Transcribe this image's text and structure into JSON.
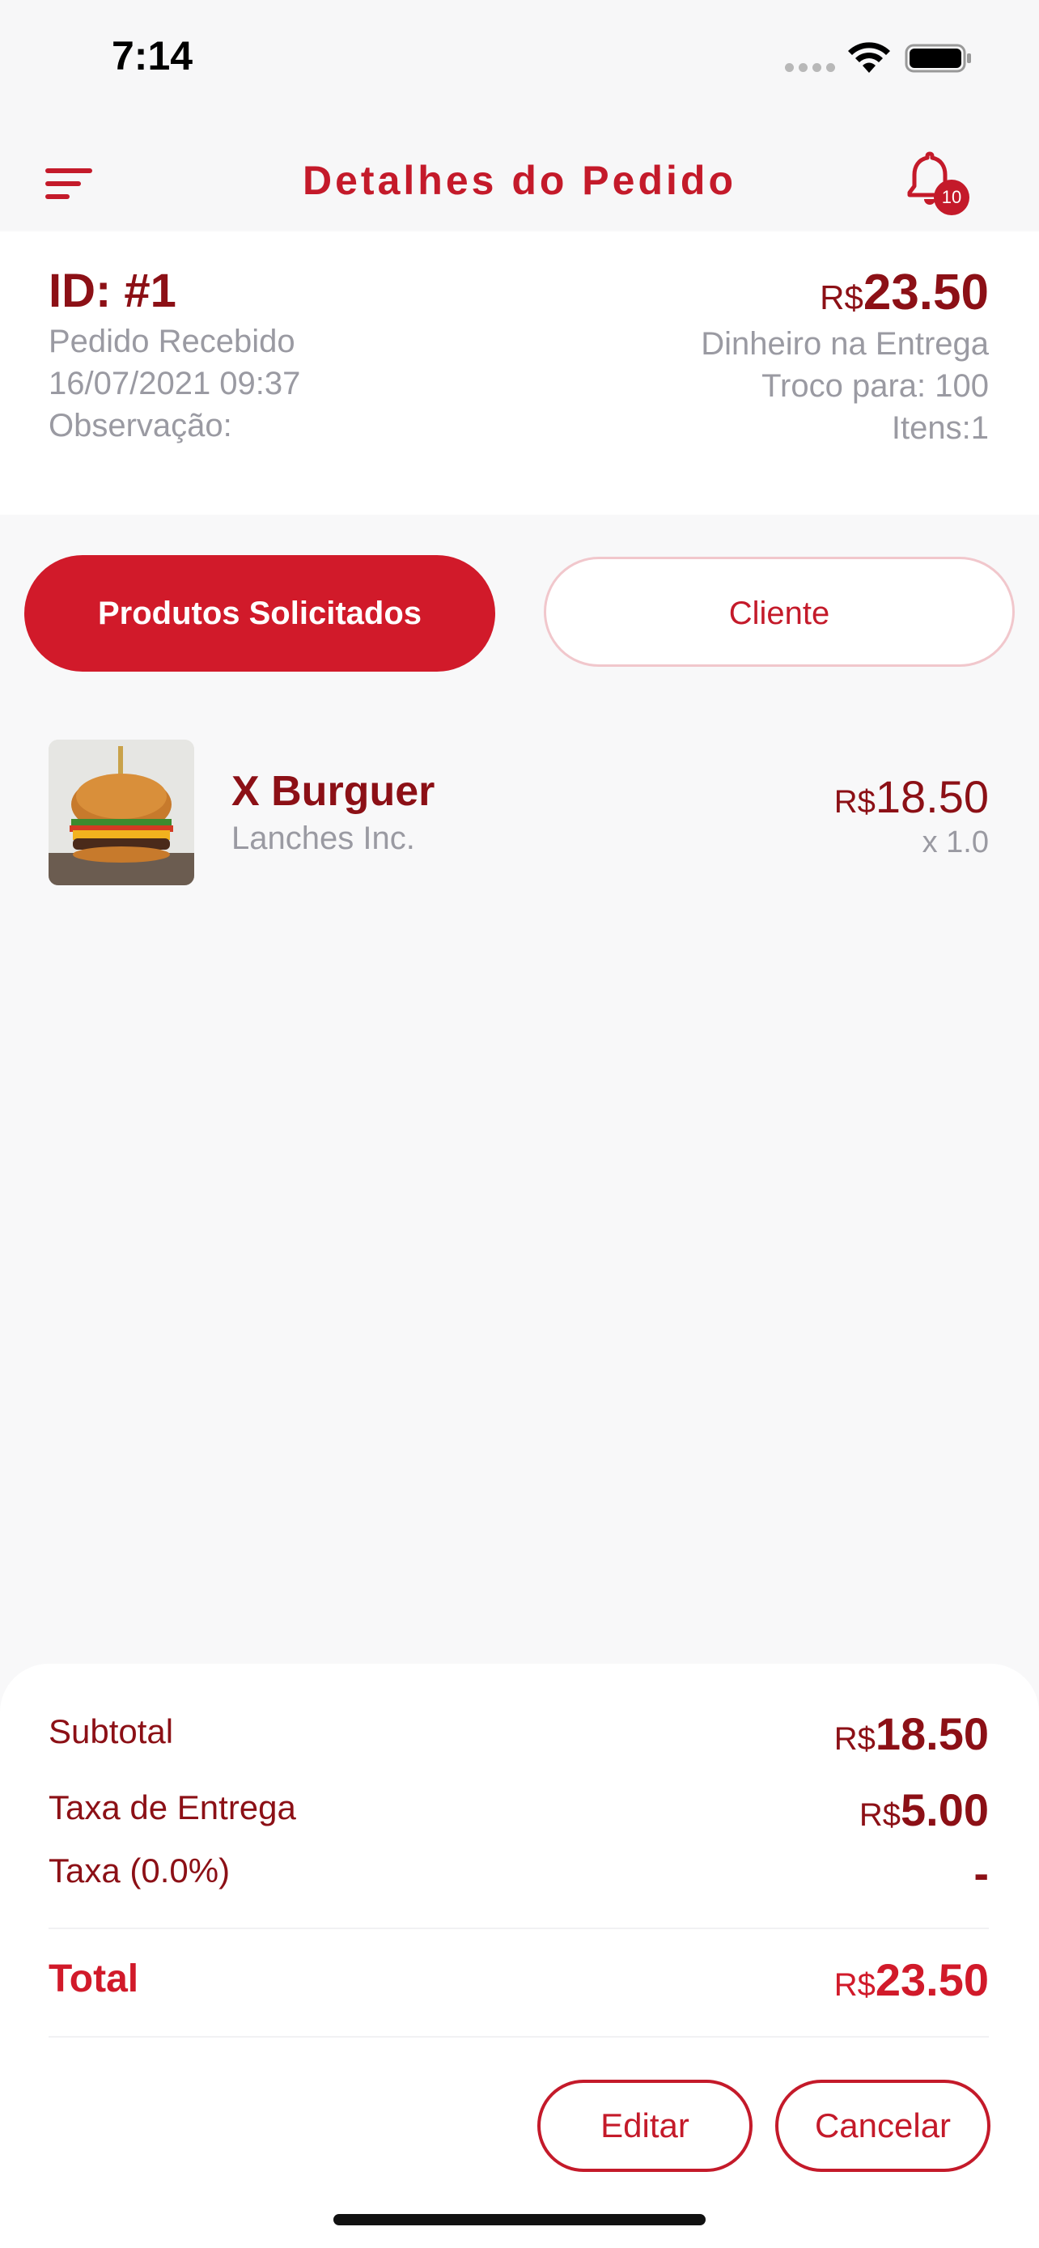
{
  "status_bar": {
    "time": "7:14"
  },
  "header": {
    "title": "Detalhes do Pedido",
    "notification_count": "10"
  },
  "order": {
    "id": "ID: #1",
    "status": "Pedido Recebido",
    "datetime": "16/07/2021 09:37",
    "note_label": "Observação:",
    "currency": "R$",
    "total": "23.50",
    "payment_method": "Dinheiro na Entrega",
    "change_for": "Troco para: 100",
    "items_count": "Itens:1"
  },
  "tabs": [
    {
      "label": "Produtos Solicitados",
      "active": true
    },
    {
      "label": "Cliente",
      "active": false
    }
  ],
  "products": [
    {
      "name": "X Burguer",
      "vendor": "Lanches Inc.",
      "currency": "R$",
      "price": "18.50",
      "quantity": "x 1.0"
    }
  ],
  "summary": {
    "subtotal_label": "Subtotal",
    "subtotal_currency": "R$",
    "subtotal_value": "18.50",
    "delivery_label": "Taxa de Entrega",
    "delivery_currency": "R$",
    "delivery_value": "5.00",
    "tax_label": "Taxa (0.0%)",
    "tax_value": "-",
    "total_label": "Total",
    "total_currency": "R$",
    "total_value": "23.50"
  },
  "actions": {
    "edit_label": "Editar",
    "cancel_label": "Cancelar"
  },
  "colors": {
    "accent": "#d11a2a",
    "dark_red": "#8c1016",
    "muted_text": "#9a9aa2",
    "background": "#f8f8f9"
  },
  "icons": {
    "menu": "menu-lines-icon",
    "notifications": "bell-icon",
    "wifi": "wifi-icon",
    "battery": "battery-icon"
  }
}
